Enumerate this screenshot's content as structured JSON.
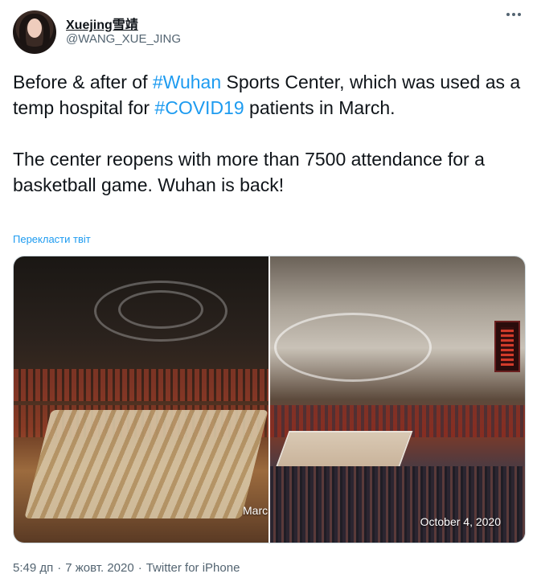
{
  "author": {
    "display_name": "Xuejing雪靖",
    "handle": "@WANG_XUE_JING"
  },
  "tweet": {
    "line1_before": "Before & after of ",
    "tag1": "#Wuhan",
    "line1_mid": " Sports Center, which was used as a temp hospital for ",
    "tag2": "#COVID19",
    "line1_after": " patients in March.",
    "paragraph2": "The center reopens with more than 7500 attendance for a basketball game. Wuhan is back!",
    "translate_label": "Перекласти твіт"
  },
  "media": {
    "left_caption": "Marc",
    "right_caption": "October 4, 2020"
  },
  "meta": {
    "time": "5:49 дп",
    "date": "7 жовт. 2020",
    "source": "Twitter for iPhone",
    "separator": "·"
  },
  "icons": {
    "more": "more-horizontal-icon"
  },
  "colors": {
    "link": "#1d9bf0",
    "secondary_text": "#536471",
    "primary_text": "#0f1419"
  }
}
